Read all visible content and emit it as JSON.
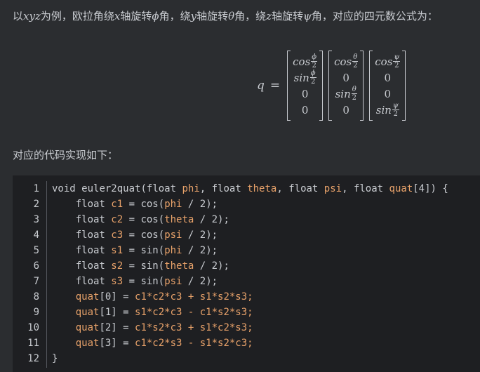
{
  "intro": {
    "p1": "以",
    "v1": "xyz",
    "p2": "为例，欧拉角绕",
    "v2": "x",
    "p3": "轴旋转",
    "v3": "ϕ",
    "p4": "角，绕",
    "v4": "y",
    "p5": "轴旋转",
    "v5": "θ",
    "p6": "角，绕",
    "v6": "z",
    "p7": "轴旋转",
    "v7": "ψ",
    "p8": "角，对应的四元数公式为："
  },
  "formula": {
    "lhs": "q",
    "eq": "=",
    "den": "2",
    "matrices": [
      [
        {
          "fn": "cos",
          "num": "ϕ"
        },
        {
          "fn": "sin",
          "num": "ϕ"
        },
        {
          "plain": "0"
        },
        {
          "plain": "0"
        }
      ],
      [
        {
          "fn": "cos",
          "num": "θ"
        },
        {
          "plain": "0"
        },
        {
          "fn": "sin",
          "num": "θ"
        },
        {
          "plain": "0"
        }
      ],
      [
        {
          "fn": "cos",
          "num": "ψ"
        },
        {
          "plain": "0"
        },
        {
          "plain": "0"
        },
        {
          "fn": "sin",
          "num": "ψ"
        }
      ]
    ]
  },
  "code_intro": "对应的代码实现如下：",
  "colors": {
    "default": "#c9ccd1",
    "keyword": "#cf8e6d",
    "param": "#e8a26a",
    "number": "#c9ccd1"
  },
  "code": {
    "lines": [
      {
        "n": "1",
        "tokens": [
          [
            "void ",
            "default"
          ],
          [
            "euler2quat",
            "default"
          ],
          [
            "(",
            "default"
          ],
          [
            "float ",
            "default"
          ],
          [
            "phi",
            "param"
          ],
          [
            ", ",
            "default"
          ],
          [
            "float ",
            "default"
          ],
          [
            "theta",
            "param"
          ],
          [
            ", ",
            "default"
          ],
          [
            "float ",
            "default"
          ],
          [
            "psi",
            "param"
          ],
          [
            ", ",
            "default"
          ],
          [
            "float ",
            "default"
          ],
          [
            "quat",
            "param"
          ],
          [
            "[4]) {",
            "default"
          ]
        ]
      },
      {
        "n": "2",
        "tokens": [
          [
            "    float ",
            "default"
          ],
          [
            "c1",
            "param"
          ],
          [
            " = ",
            "default"
          ],
          [
            "cos",
            "default"
          ],
          [
            "(",
            "default"
          ],
          [
            "phi",
            "param"
          ],
          [
            " / 2);",
            "default"
          ]
        ]
      },
      {
        "n": "3",
        "tokens": [
          [
            "    float ",
            "default"
          ],
          [
            "c2",
            "param"
          ],
          [
            " = ",
            "default"
          ],
          [
            "cos",
            "default"
          ],
          [
            "(",
            "default"
          ],
          [
            "theta",
            "param"
          ],
          [
            " / 2);",
            "default"
          ]
        ]
      },
      {
        "n": "4",
        "tokens": [
          [
            "    float ",
            "default"
          ],
          [
            "c3",
            "param"
          ],
          [
            " = ",
            "default"
          ],
          [
            "cos",
            "default"
          ],
          [
            "(",
            "default"
          ],
          [
            "psi",
            "param"
          ],
          [
            " / 2);",
            "default"
          ]
        ]
      },
      {
        "n": "5",
        "tokens": [
          [
            "    float ",
            "default"
          ],
          [
            "s1",
            "param"
          ],
          [
            " = ",
            "default"
          ],
          [
            "sin",
            "default"
          ],
          [
            "(",
            "default"
          ],
          [
            "phi",
            "param"
          ],
          [
            " / 2);",
            "default"
          ]
        ]
      },
      {
        "n": "6",
        "tokens": [
          [
            "    float ",
            "default"
          ],
          [
            "s2",
            "param"
          ],
          [
            " = ",
            "default"
          ],
          [
            "sin",
            "default"
          ],
          [
            "(",
            "default"
          ],
          [
            "theta",
            "param"
          ],
          [
            " / 2);",
            "default"
          ]
        ]
      },
      {
        "n": "7",
        "tokens": [
          [
            "    float ",
            "default"
          ],
          [
            "s3",
            "param"
          ],
          [
            " = ",
            "default"
          ],
          [
            "sin",
            "default"
          ],
          [
            "(",
            "default"
          ],
          [
            "psi",
            "param"
          ],
          [
            " / 2);",
            "default"
          ]
        ]
      },
      {
        "n": "8",
        "tokens": [
          [
            "    ",
            "default"
          ],
          [
            "quat",
            "param"
          ],
          [
            "[0] = ",
            "default"
          ],
          [
            "c1*c2*c3 + s1*s2*s3;",
            "param"
          ]
        ]
      },
      {
        "n": "9",
        "tokens": [
          [
            "    ",
            "default"
          ],
          [
            "quat",
            "param"
          ],
          [
            "[1] = ",
            "default"
          ],
          [
            "s1*c2*c3 - c1*s2*s3;",
            "param"
          ]
        ]
      },
      {
        "n": "10",
        "tokens": [
          [
            "    ",
            "default"
          ],
          [
            "quat",
            "param"
          ],
          [
            "[2] = ",
            "default"
          ],
          [
            "c1*s2*c3 + s1*c2*s3;",
            "param"
          ]
        ]
      },
      {
        "n": "11",
        "tokens": [
          [
            "    ",
            "default"
          ],
          [
            "quat",
            "param"
          ],
          [
            "[3] = ",
            "default"
          ],
          [
            "c1*c2*s3 - s1*s2*c3;",
            "param"
          ]
        ]
      },
      {
        "n": "12",
        "tokens": [
          [
            "}",
            "default"
          ]
        ]
      }
    ]
  }
}
